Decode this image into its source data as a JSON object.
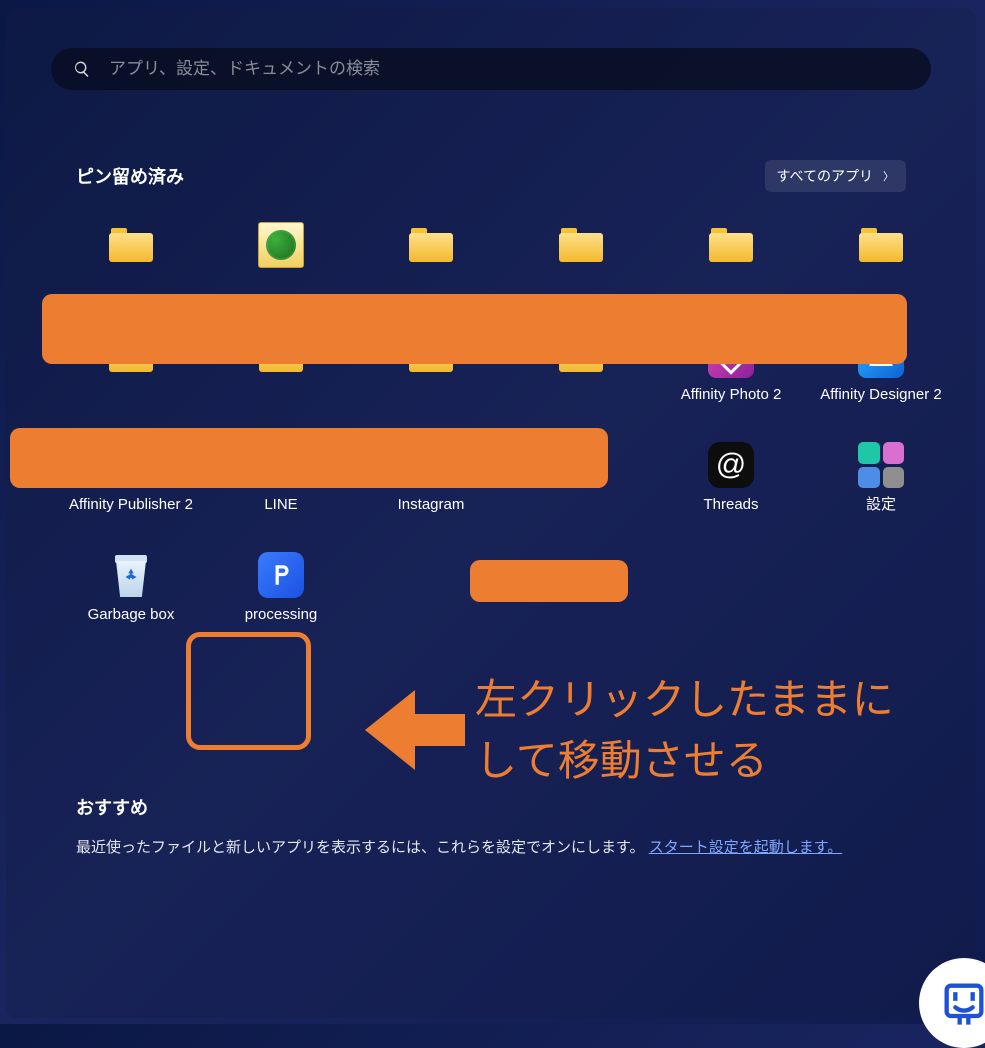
{
  "search": {
    "placeholder": "アプリ、設定、ドキュメントの検索"
  },
  "sections": {
    "pinned_title": "ピン留め済み",
    "all_apps_label": "すべてのアプリ",
    "recommend_title": "おすすめ",
    "recommend_text": "最近使ったファイルと新しいアプリを表示するには、これらを設定でオンにします。",
    "recommend_link": "スタート設定を起動します。"
  },
  "pinned_rows": {
    "row1": [
      {
        "icon": "folder",
        "label": ""
      },
      {
        "icon": "world-folder",
        "label": ""
      },
      {
        "icon": "folder",
        "label": ""
      },
      {
        "icon": "folder",
        "label": ""
      },
      {
        "icon": "folder",
        "label": ""
      },
      {
        "icon": "folder",
        "label": ""
      }
    ],
    "row2": [
      {
        "icon": "folder",
        "label": ""
      },
      {
        "icon": "folder",
        "label": ""
      },
      {
        "icon": "folder",
        "label": ""
      },
      {
        "icon": "folder",
        "label": ""
      },
      {
        "icon": "affinity-photo",
        "label": "Affinity Photo 2"
      },
      {
        "icon": "affinity-designer",
        "label": "Affinity Designer 2"
      }
    ],
    "row3": [
      {
        "icon": "affinity-publisher",
        "label": "Affinity Publisher 2"
      },
      {
        "icon": "line",
        "label": "LINE"
      },
      {
        "icon": "instagram",
        "label": "Instagram"
      },
      {
        "icon": "photos",
        "label": ""
      },
      {
        "icon": "threads",
        "label": "Threads"
      },
      {
        "icon": "settings",
        "label": "設定"
      }
    ],
    "row4": [
      {
        "icon": "recyclebin",
        "label": "Garbage box"
      },
      {
        "icon": "processing",
        "label": "processing"
      }
    ]
  },
  "annotation": {
    "line1": "左クリックしたままに",
    "line2": "して移動させる"
  },
  "line_text": "LINE",
  "colors": {
    "accent_orange": "#ed7d31"
  }
}
